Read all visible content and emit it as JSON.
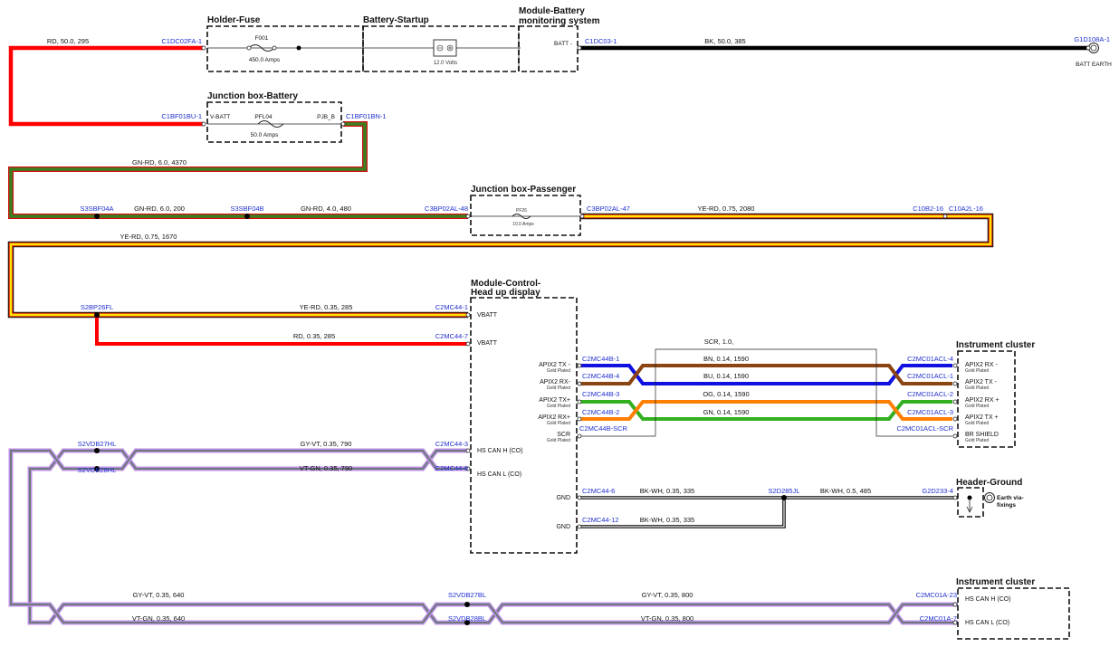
{
  "boxes": {
    "holder_fuse": "Holder-Fuse",
    "battery_startup": "Battery-Startup",
    "module_battery_line1": "Module-Battery",
    "module_battery_line2": "monitoring system",
    "junction_battery": "Junction box-Battery",
    "junction_passenger": "Junction box-Passenger",
    "module_hud_line1": "Module-Control-",
    "module_hud_line2": "Head up display",
    "instrument_cluster_1": "Instrument cluster",
    "header_ground": "Header-Ground",
    "instrument_cluster_2": "Instrument cluster"
  },
  "components": {
    "f001_name": "F001",
    "f001_rating": "450.0 Amps",
    "battery_rating": "12.0 Volts",
    "batt_pin": "BATT -",
    "pfl04_name": "PFL04",
    "pfl04_rating": "50.0 Amps",
    "vbatt_pin": "V-BATT",
    "pjb_pin": "PJB_B",
    "pf26_name": "PF26",
    "pf26_rating": "10.0 Amps",
    "batt_earth": "BATT EARTH",
    "earth_via_1": "Earth via-",
    "earth_via_2": "fixings"
  },
  "connectors": {
    "c1dc02fa": "C1DC02FA-1",
    "c1dc03": "C1DC03-1",
    "g1d108a": "G1D108A-1",
    "c1bf01bu": "C1BF01BU-1",
    "c1bf01bn": "C1BF01BN-1",
    "s3sbf04a": "S3SBF04A",
    "s3sbf04b": "S3SBF04B",
    "c3bp02al48": "C3BP02AL-48",
    "c3bp02al47": "C3BP02AL-47",
    "c10b2": "C10B2-16",
    "c10a2l": "C10A2L-16",
    "s2bp26fl": "S2BP26FL",
    "c2mc44_1": "C2MC44-1",
    "c2mc44_7": "C2MC44-7",
    "c2mc44b_1": "C2MC44B-1",
    "c2mc44b_4": "C2MC44B-4",
    "c2mc44b_3": "C2MC44B-3",
    "c2mc44b_2": "C2MC44B-2",
    "c2mc44b_scr": "C2MC44B-SCR",
    "c2mc01acl_4": "C2MC01ACL-4",
    "c2mc01acl_1": "C2MC01ACL-1",
    "c2mc01acl_2": "C2MC01ACL-2",
    "c2mc01acl_3": "C2MC01ACL-3",
    "c2mc01acl_scr": "C2MC01ACL-SCR",
    "s2vdb27hl": "S2VDB27HL",
    "s2vdb28hl": "S2VDB28HL",
    "c2mc44_3": "C2MC44-3",
    "c2mc44_9": "C2MC44-9",
    "c2mc44_6": "C2MC44-6",
    "c2mc44_12": "C2MC44-12",
    "s2d285jl": "S2D285JL",
    "g2d233": "G2D233-4",
    "s2vdb27bl": "S2VDB27BL",
    "s2vdb28bl": "S2VDB28BL",
    "c2mc01a_23": "C2MC01A-23",
    "c2mc01a_7": "C2MC01A-7"
  },
  "wires": {
    "rd_295": "RD, 50.0, 295",
    "bk_385": "BK, 50.0, 385",
    "gnrd_4370": "GN-RD, 6.0, 4370",
    "gnrd_200": "GN-RD, 6.0, 200",
    "gnrd_480": "GN-RD, 4.0, 480",
    "yerd_2080": "YE-RD, 0.75, 2080",
    "yerd_1670": "YE-RD, 0.75, 1670",
    "yerd_285": "YE-RD, 0.35, 285",
    "rd_285": "RD, 0.35, 285",
    "scr": "SCR, 1.0,",
    "bn": "BN, 0.14, 1590",
    "bu": "BU, 0.14, 1590",
    "og": "OG, 0.14, 1590",
    "gn": "GN, 0.14, 1590",
    "gyvt_790": "GY-VT, 0.35, 790",
    "vtgn_790": "VT-GN, 0.35, 790",
    "bkwh_335a": "BK-WH, 0.35, 335",
    "bkwh_485": "BK-WH, 0.5, 485",
    "bkwh_335b": "BK-WH, 0.35, 335",
    "gyvt_640": "GY-VT, 0.35, 640",
    "vtgn_640": "VT-GN, 0.35, 640",
    "gyvt_800": "GY-VT, 0.35, 800",
    "vtgn_800": "VT-GN, 0.35, 800"
  },
  "pins": {
    "vbatt1": "VBATT",
    "vbatt2": "VBATT",
    "apix_tx_minus": "APIX2 TX -",
    "apix_rx_minus": "APIX2 RX-",
    "apix_tx_plus": "APIX2 TX+",
    "apix_rx_plus": "APIX2 RX+",
    "scr": "SCR",
    "gold": "Gold Plated",
    "ic_rx_minus": "APIX2 RX -",
    "ic_tx_minus": "APIX2 TX -",
    "ic_rx_plus": "APIX2 RX +",
    "ic_tx_plus": "APIX2 TX +",
    "ic_shield": "BR SHIELD",
    "hs_can_h": "HS CAN H (CO)",
    "hs_can_l": "HS CAN L (CO)",
    "gnd1": "GND",
    "gnd2": "GND",
    "ic2_can_h": "HS CAN H (CO)",
    "ic2_can_l": "HS CAN L (CO)"
  },
  "colors": {
    "red": "#ff0000",
    "black": "#000000",
    "green": "#2e7d1e",
    "yellow": "#ffe600",
    "brown": "#8b4513",
    "blue": "#1010e0",
    "orange": "#ff8000",
    "grn": "#33b020",
    "grey": "#7a8a8a",
    "violet": "#c090e8",
    "connector_text": "#1f2fd0"
  }
}
